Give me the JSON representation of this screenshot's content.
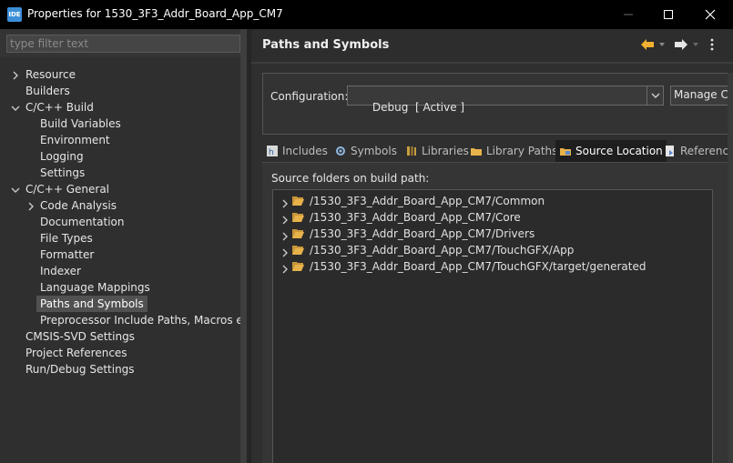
{
  "window": {
    "app_icon_text": "IDE",
    "title": "Properties for 1530_3F3_Addr_Board_App_CM7",
    "controls": [
      "minimize-icon",
      "maximize-icon",
      "close-icon"
    ]
  },
  "sidebar": {
    "filter_placeholder": "type filter text",
    "items": [
      {
        "label": "Resource",
        "expander": "collapsed"
      },
      {
        "label": "Builders",
        "expander": "none"
      },
      {
        "label": "C/C++ Build",
        "expander": "expanded"
      },
      {
        "label": "Build Variables",
        "expander": "none"
      },
      {
        "label": "Environment",
        "expander": "none"
      },
      {
        "label": "Logging",
        "expander": "none"
      },
      {
        "label": "Settings",
        "expander": "none"
      },
      {
        "label": "C/C++ General",
        "expander": "expanded"
      },
      {
        "label": "Code Analysis",
        "expander": "collapsed"
      },
      {
        "label": "Documentation",
        "expander": "none"
      },
      {
        "label": "File Types",
        "expander": "none"
      },
      {
        "label": "Formatter",
        "expander": "none"
      },
      {
        "label": "Indexer",
        "expander": "none"
      },
      {
        "label": "Language Mappings",
        "expander": "none"
      },
      {
        "label": "Paths and Symbols",
        "expander": "none",
        "selected": true
      },
      {
        "label": "Preprocessor Include Paths, Macros etc.",
        "expander": "none"
      },
      {
        "label": "CMSIS-SVD Settings",
        "expander": "none"
      },
      {
        "label": "Project References",
        "expander": "none"
      },
      {
        "label": "Run/Debug Settings",
        "expander": "none"
      }
    ]
  },
  "main": {
    "title": "Paths and Symbols",
    "nav_icons": [
      "back-arrow-icon",
      "forward-arrow-icon",
      "view-menu-icon"
    ],
    "configuration": {
      "label": "Configuration:",
      "value": "Debug  [ Active ]",
      "manage_label": "Manage Co"
    },
    "tabs": [
      {
        "label": "Includes",
        "icon": "includes-icon"
      },
      {
        "label": "Symbols",
        "icon": "symbols-icon"
      },
      {
        "label": "Libraries",
        "icon": "libraries-icon"
      },
      {
        "label": "Library Paths",
        "icon": "library-paths-icon"
      },
      {
        "label": "Source Location",
        "icon": "source-location-icon",
        "active": true
      },
      {
        "label": "Reference",
        "icon": "references-icon"
      }
    ],
    "source_label": "Source folders on build path:",
    "source_folders": [
      "/1530_3F3_Addr_Board_App_CM7/Common",
      "/1530_3F3_Addr_Board_App_CM7/Core",
      "/1530_3F3_Addr_Board_App_CM7/Drivers",
      "/1530_3F3_Addr_Board_App_CM7/TouchGFX/App",
      "/1530_3F3_Addr_Board_App_CM7/TouchGFX/target/generated"
    ]
  },
  "colors": {
    "titlebar": "#000000",
    "panel": "#2f2f2f",
    "selection": "#515151",
    "folder": "#e8b24a",
    "arrow": "#f0b030"
  }
}
